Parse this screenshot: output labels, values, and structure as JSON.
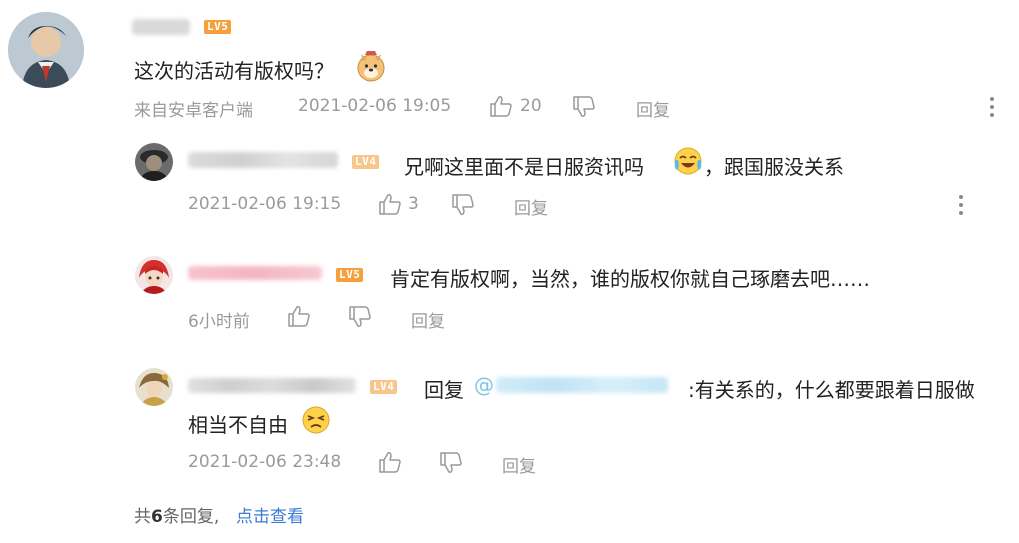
{
  "main_comment": {
    "level_badge": "LV5",
    "text": "这次的活动有版权吗？",
    "source": "来自安卓客户端",
    "timestamp": "2021-02-06 19:05",
    "like_count": "20",
    "reply_label": "回复"
  },
  "replies": [
    {
      "level_badge": "LV4",
      "text": "兄啊这里面不是日服资讯吗",
      "text_after_emoji": "，跟国服没关系",
      "timestamp": "2021-02-06 19:15",
      "like_count": "3",
      "reply_label": "回复"
    },
    {
      "level_badge": "LV5",
      "text": "肯定有版权啊，当然，谁的版权你就自己琢磨去吧……",
      "timestamp": "6小时前",
      "reply_label": "回复"
    },
    {
      "level_badge": "LV4",
      "reply_prefix": "回复",
      "at_symbol": "@",
      "text_line1": ":有关系的，什么都要跟着日服做",
      "text_line2": "相当不自由",
      "timestamp": "2021-02-06 23:48",
      "reply_label": "回复"
    }
  ],
  "footer": {
    "prefix": "共",
    "count": "6",
    "suffix": "条回复,",
    "view_link": "点击查看"
  },
  "colors": {
    "level_orange": "#f5a03c",
    "level_orange_light": "#f8c58a",
    "link_blue": "#3a7bd5",
    "meta_gray": "#9a9a9a"
  }
}
